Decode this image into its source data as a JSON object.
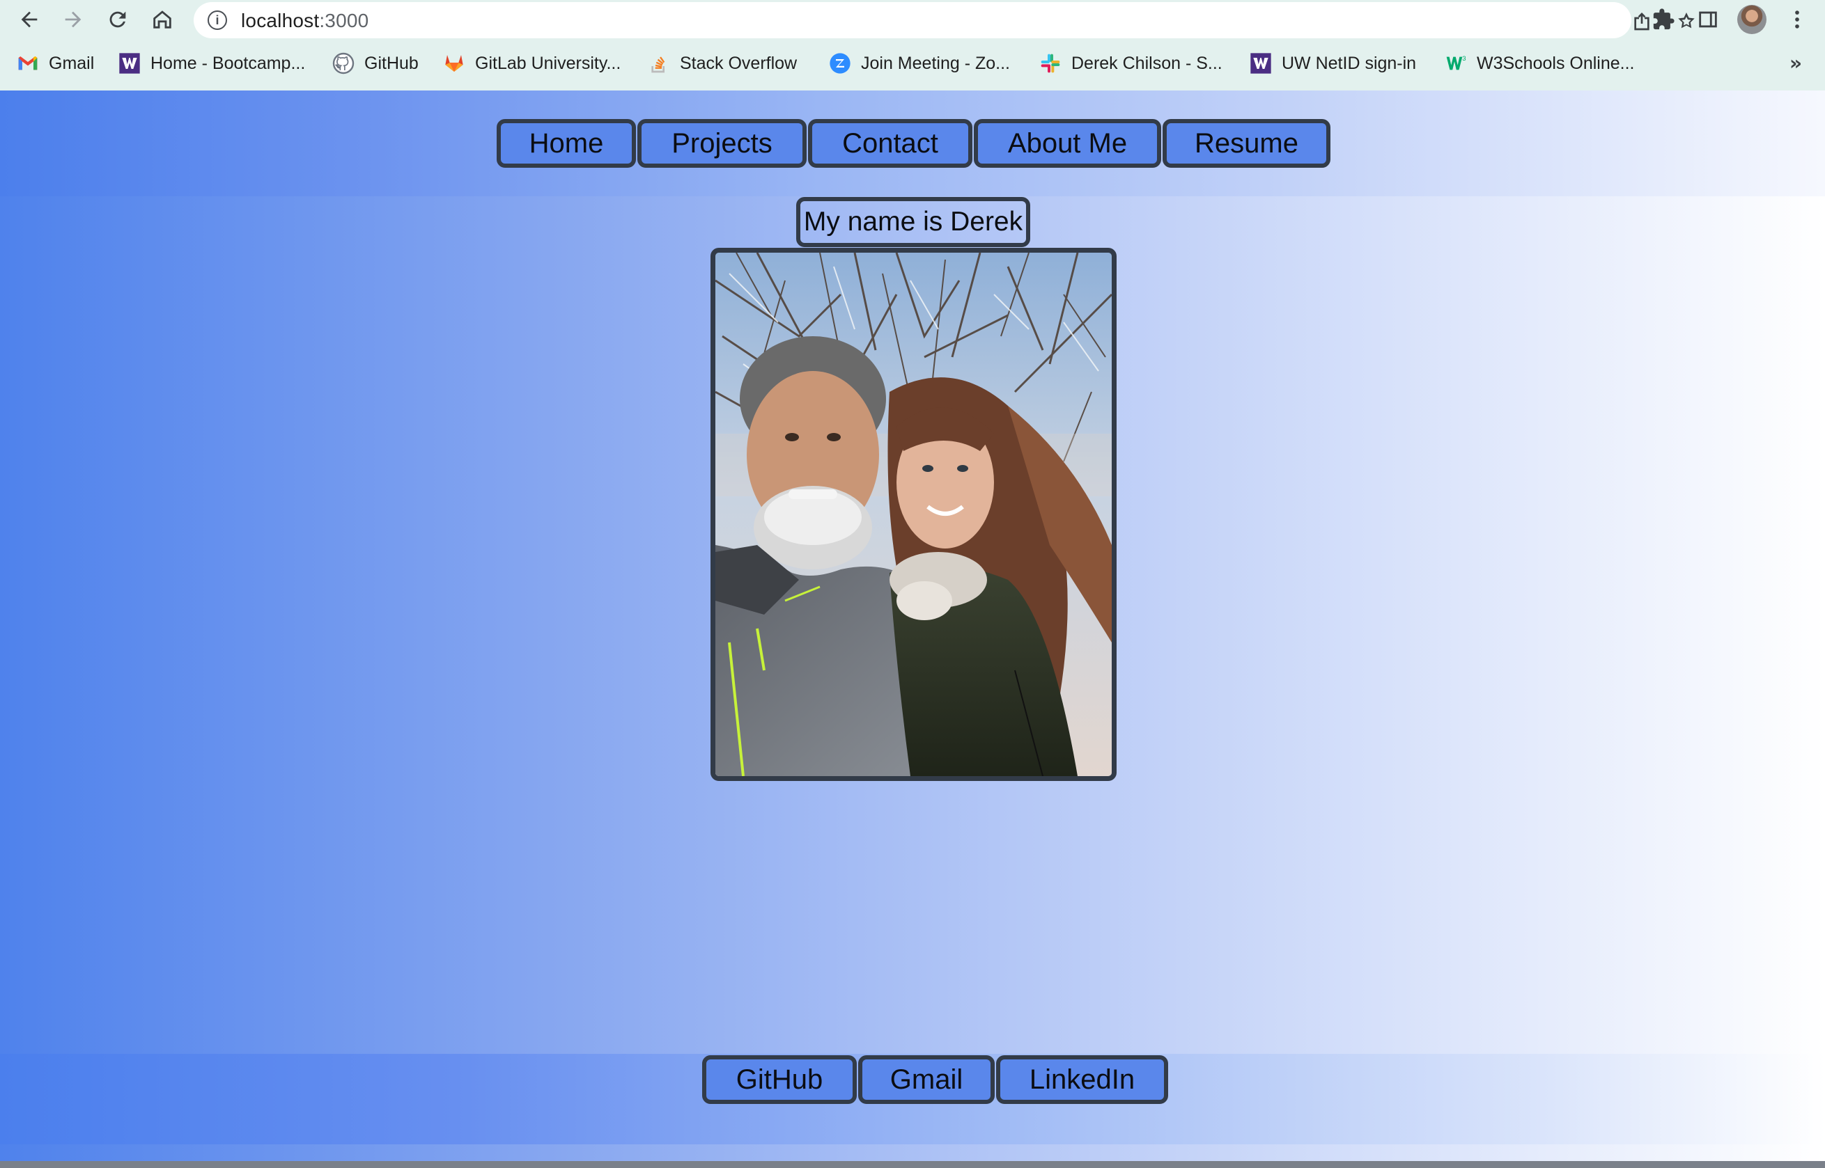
{
  "browser": {
    "url_host": "localhost",
    "url_port": ":3000",
    "bookmarks": [
      {
        "label": "Gmail",
        "icon": "gmail-icon"
      },
      {
        "label": "Home - Bootcamp...",
        "icon": "uw-w-icon"
      },
      {
        "label": "GitHub",
        "icon": "github-icon"
      },
      {
        "label": "GitLab University...",
        "icon": "gitlab-icon"
      },
      {
        "label": "Stack Overflow",
        "icon": "stackoverflow-icon"
      },
      {
        "label": "Join Meeting - Zo...",
        "icon": "zoom-icon"
      },
      {
        "label": "Derek Chilson - S...",
        "icon": "slack-icon"
      },
      {
        "label": "UW NetID sign-in",
        "icon": "uw-w-icon"
      },
      {
        "label": "W3Schools Online...",
        "icon": "w3schools-icon"
      }
    ],
    "more_bookmarks": "»"
  },
  "nav": {
    "items": [
      "Home",
      "Projects",
      "Contact",
      "About Me",
      "Resume"
    ]
  },
  "main": {
    "title": "My name is Derek"
  },
  "footer": {
    "links": [
      "GitHub",
      "Gmail",
      "LinkedIn"
    ]
  },
  "colors": {
    "button_fill": "#5a87eb",
    "button_border": "#323b48",
    "gradient_start": "#4f82ec",
    "gradient_end": "#ffffff",
    "chrome_bg": "#e3f1ee"
  }
}
